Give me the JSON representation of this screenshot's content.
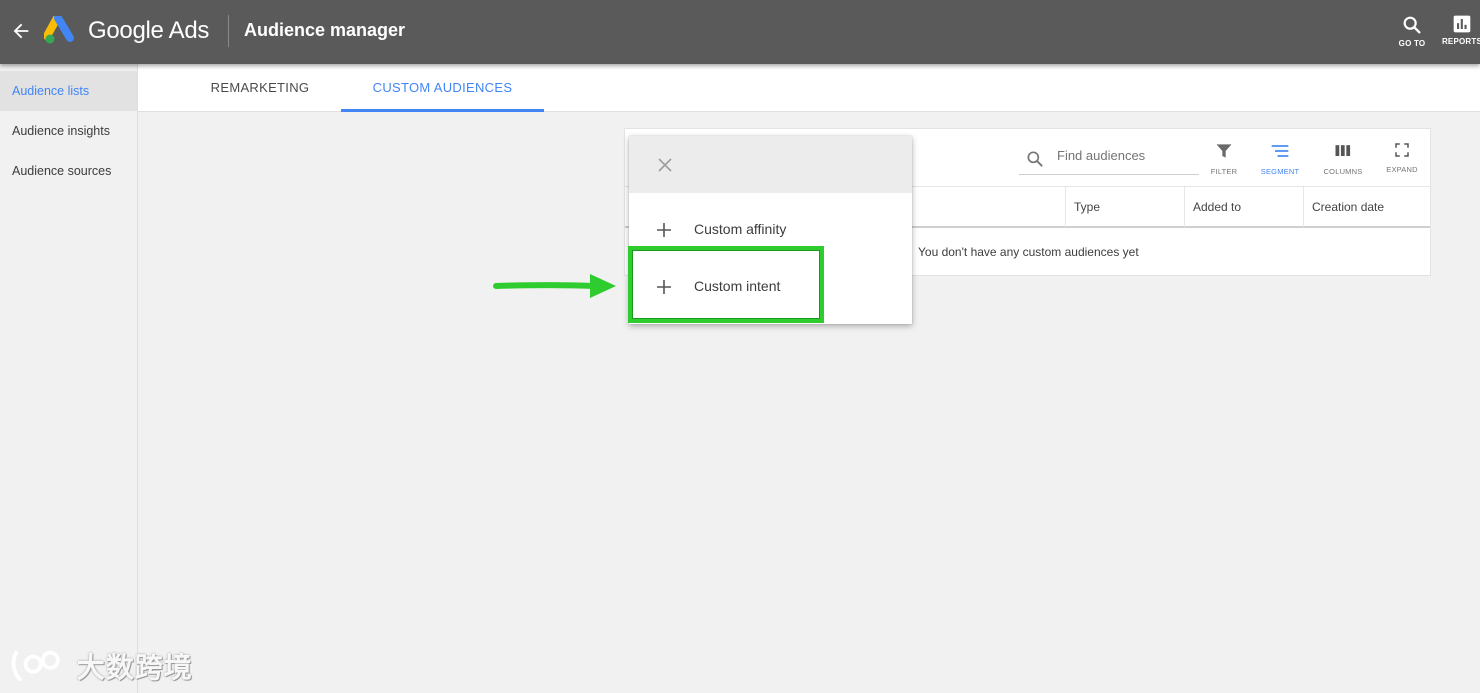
{
  "header": {
    "product_name": "Google Ads",
    "page_title": "Audience manager",
    "tools": [
      {
        "label": "GO TO",
        "icon": "search-icon"
      },
      {
        "label": "REPORTS",
        "icon": "reports-icon"
      }
    ]
  },
  "sidebar": {
    "items": [
      {
        "label": "Audience lists",
        "active": true
      },
      {
        "label": "Audience insights",
        "active": false
      },
      {
        "label": "Audience sources",
        "active": false
      }
    ]
  },
  "tabs": [
    {
      "label": "REMARKETING",
      "active": false
    },
    {
      "label": "CUSTOM AUDIENCES",
      "active": true
    }
  ],
  "table": {
    "search_placeholder": "Find audiences",
    "controls": [
      {
        "label": "FILTER",
        "icon": "filter-icon",
        "active": false
      },
      {
        "label": "SEGMENT",
        "icon": "segment-icon",
        "active": true
      },
      {
        "label": "COLUMNS",
        "icon": "columns-icon",
        "active": false
      },
      {
        "label": "EXPAND",
        "icon": "expand-icon",
        "active": false
      }
    ],
    "columns": [
      "Type",
      "Added to",
      "Creation date"
    ],
    "empty_message": "You don't have any custom audiences yet"
  },
  "menu": {
    "items": [
      {
        "label": "Custom affinity",
        "icon": "plus-icon"
      },
      {
        "label": "Custom intent",
        "icon": "plus-icon"
      }
    ]
  },
  "annotation": {
    "highlight_color": "#2ecc2e"
  },
  "watermark": {
    "text": "大数跨境"
  },
  "colors": {
    "topbar": "#5a5a5a",
    "accent": "#4285f4",
    "background": "#f1f1f1"
  }
}
